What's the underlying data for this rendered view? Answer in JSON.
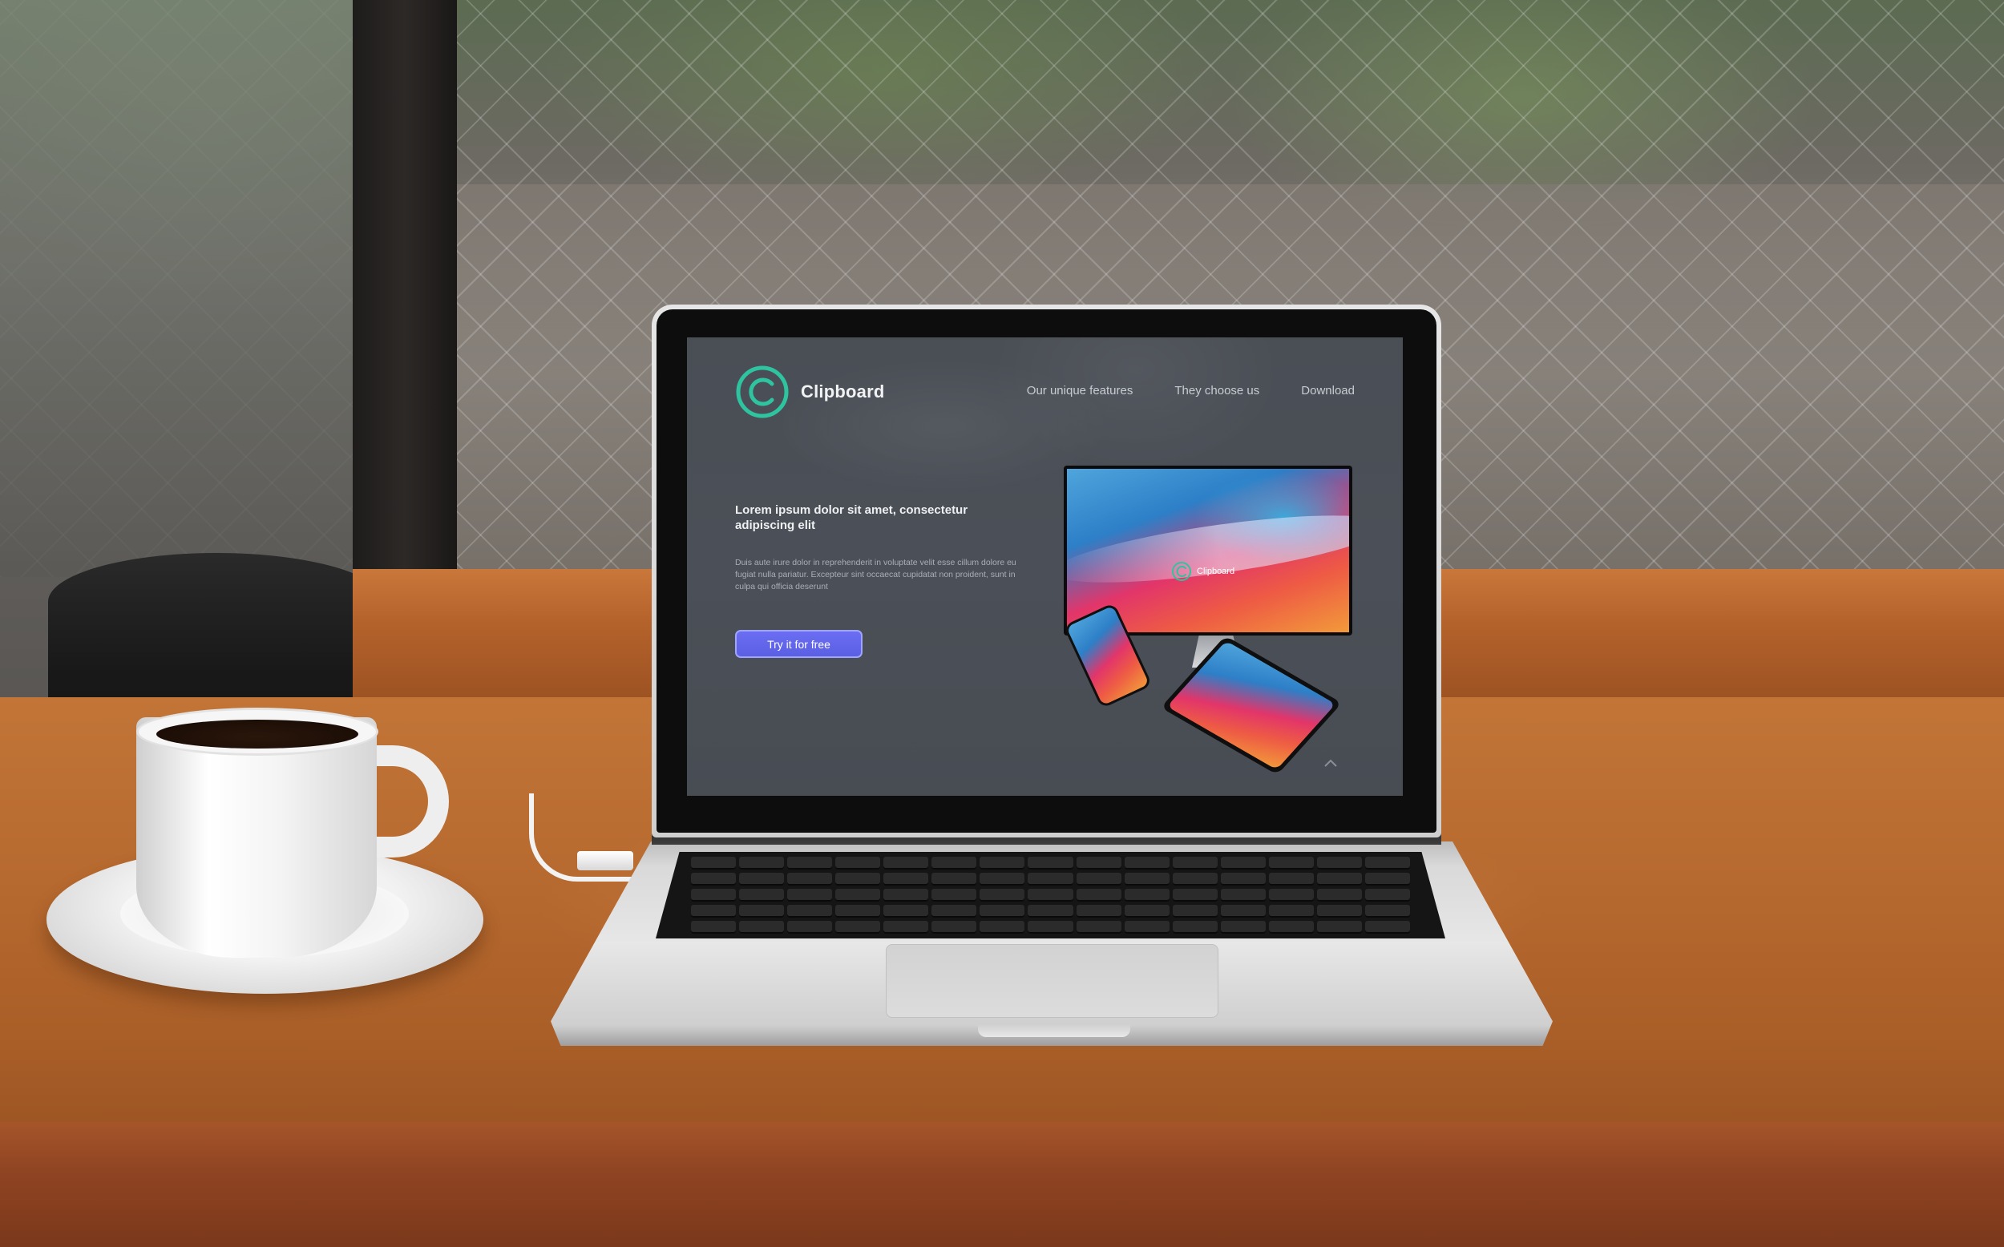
{
  "site": {
    "brand": "Clipboard",
    "nav": [
      {
        "label": "Our unique features"
      },
      {
        "label": "They choose us"
      },
      {
        "label": "Download"
      }
    ],
    "hero": {
      "title": "Lorem ipsum dolor sit amet, consectetur adipiscing elit",
      "body": "Duis aute irure dolor in reprehenderit in voluptate velit esse cillum dolore eu fugiat nulla pariatur. Excepteur sint occaecat cupidatat non proident, sunt in culpa qui officia deserunt",
      "cta_label": "Try it for free"
    },
    "device_brand": "Clipboard"
  },
  "colors": {
    "brand_green": "#2ec4a0",
    "cta_blue": "#5b5fe4",
    "page_bg": "#4a4e55"
  },
  "icons": {
    "logo": "clipboard-logo-icon",
    "scroll": "chevron-up-icon"
  }
}
